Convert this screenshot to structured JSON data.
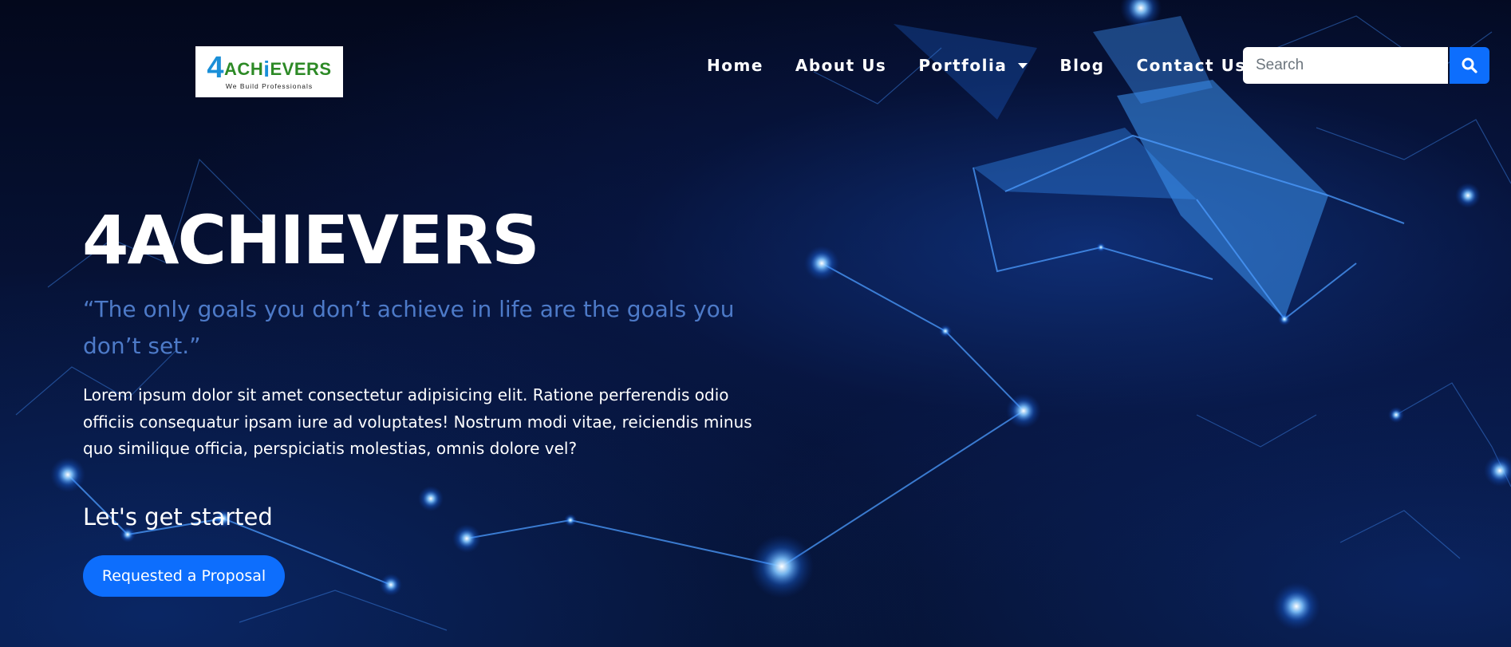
{
  "logo": {
    "four": "4",
    "ach": "ACH",
    "i": "i",
    "evers": "EVERS",
    "tagline": "We Build Professionals"
  },
  "nav": {
    "items": [
      {
        "label": "Home"
      },
      {
        "label": "About Us"
      },
      {
        "label": "Portfolia"
      },
      {
        "label": "Blog"
      },
      {
        "label": "Contact Us"
      }
    ]
  },
  "search": {
    "placeholder": "Search",
    "value": ""
  },
  "hero": {
    "title": "4ACHIEVERS",
    "quote": "“The only goals you don’t achieve in life are the goals you don’t set.”",
    "body": "Lorem ipsum dolor sit amet consectetur adipisicing elit. Ratione perferendis odio officiis consequatur ipsam iure ad voluptates! Nostrum modi vitae, reiciendis minus quo similique officia, perspiciatis molestias, omnis dolore vel?",
    "cta_heading": "Let's get started",
    "cta_button": "Requested a Proposal"
  },
  "colors": {
    "accent": "#0d6efd",
    "quote": "#4d7ac8",
    "background": "#061236"
  },
  "icons": {
    "search": "search-icon",
    "dropdown": "chevron-down-icon"
  }
}
